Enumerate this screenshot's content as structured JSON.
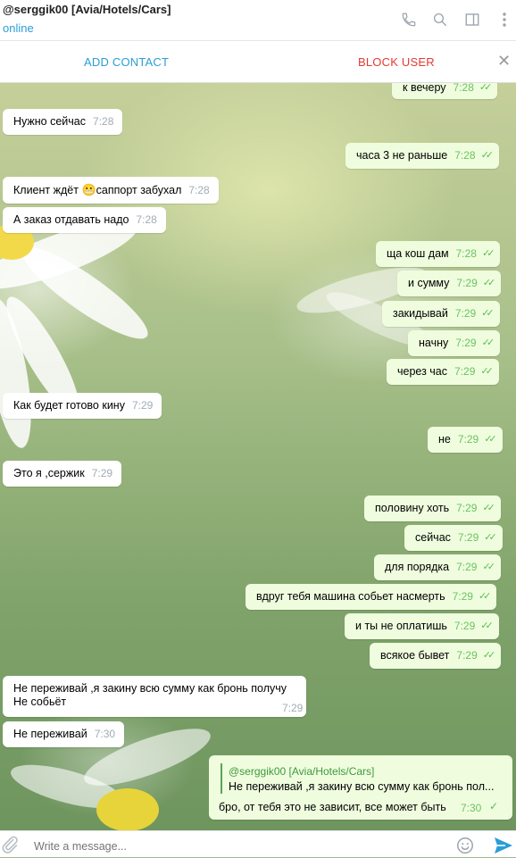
{
  "header": {
    "title": "@serggik00 [Avia/Hotels/Cars]",
    "status": "online"
  },
  "actions": {
    "add_contact": "ADD CONTACT",
    "block_user": "BLOCK USER",
    "close": "✕"
  },
  "messages": [
    {
      "dir": "out",
      "text": "к вечеру",
      "time": "7:28"
    },
    {
      "dir": "in",
      "text": "Нужно сейчас",
      "time": "7:28"
    },
    {
      "dir": "out",
      "text": "часа 3 не раньше",
      "time": "7:28"
    },
    {
      "dir": "in",
      "text_before": "Клиент ждёт",
      "emoji": "😬",
      "text_after": "саппорт забухал",
      "time": "7:28"
    },
    {
      "dir": "in",
      "text": "А заказ отдавать надо",
      "time": "7:28"
    },
    {
      "dir": "out",
      "text": "ща кош дам",
      "time": "7:28"
    },
    {
      "dir": "out",
      "text": "и сумму",
      "time": "7:29"
    },
    {
      "dir": "out",
      "text": "закидывай",
      "time": "7:29"
    },
    {
      "dir": "out",
      "text": "начну",
      "time": "7:29"
    },
    {
      "dir": "out",
      "text": "через час",
      "time": "7:29"
    },
    {
      "dir": "in",
      "text": "Как будет готово кину",
      "time": "7:29"
    },
    {
      "dir": "out",
      "text": "не",
      "time": "7:29"
    },
    {
      "dir": "in",
      "text": "Это я ,сержик",
      "time": "7:29"
    },
    {
      "dir": "out",
      "text": "половину хоть",
      "time": "7:29"
    },
    {
      "dir": "out",
      "text": "сейчас",
      "time": "7:29"
    },
    {
      "dir": "out",
      "text": "для порядка",
      "time": "7:29"
    },
    {
      "dir": "out",
      "text": "вдруг тебя машина собьет насмерть",
      "time": "7:29"
    },
    {
      "dir": "out",
      "text": "и ты не оплатишь",
      "time": "7:29"
    },
    {
      "dir": "out",
      "text": "всякое бывет",
      "time": "7:29"
    },
    {
      "dir": "in",
      "line1": "Не переживай ,я закину всю сумму как бронь получу",
      "line2": "Не собьёт",
      "time": "7:29"
    },
    {
      "dir": "in",
      "text": "Не переживай",
      "time": "7:30"
    }
  ],
  "reply_message": {
    "quoted_name": "@serggik00 [Avia/Hotels/Cars]",
    "quoted_text": "Не переживай ,я закину всю сумму как бронь пол...",
    "text": "бро, от тебя это не зависит, все может быть",
    "time": "7:30"
  },
  "composer": {
    "placeholder": "Write a message..."
  },
  "icons": [
    "phone-icon",
    "search-icon",
    "sidebar-icon",
    "more-icon",
    "attach-icon",
    "emoji-icon",
    "send-icon"
  ],
  "colors": {
    "accent": "#2a9ed6",
    "danger": "#e53935",
    "outgoing_bubble": "#effdde",
    "check": "#5dbb54"
  }
}
